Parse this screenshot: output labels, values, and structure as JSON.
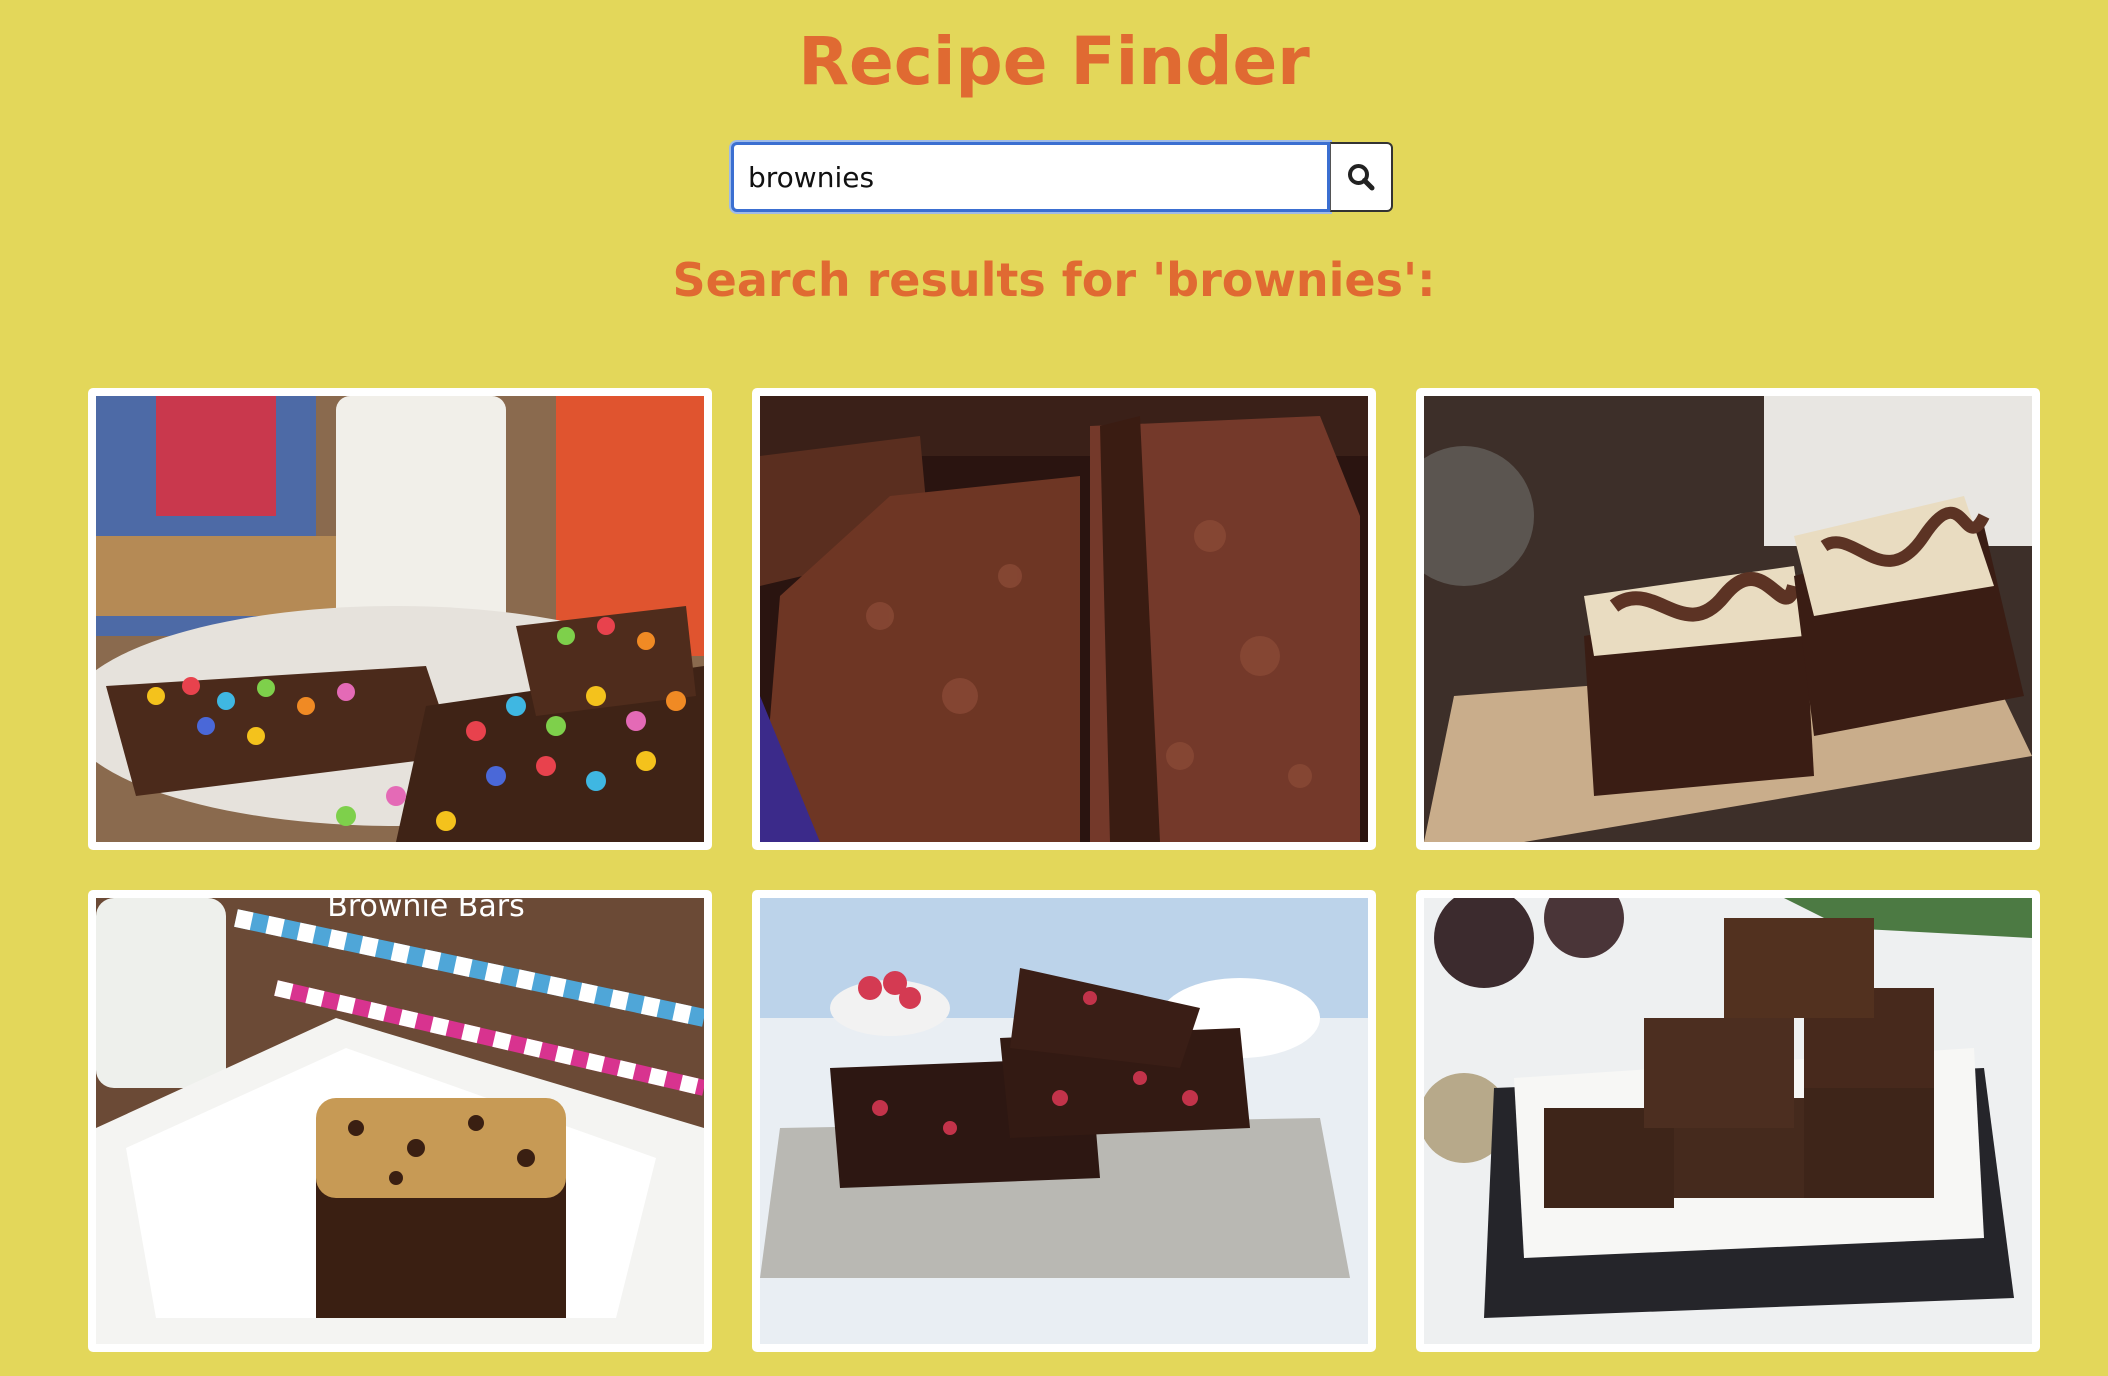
{
  "app": {
    "title": "Recipe Finder"
  },
  "search": {
    "value": "brownies",
    "button_icon": "search-icon"
  },
  "results": {
    "heading": "Search results for 'brownies':",
    "items": [
      {
        "image": "rainbow-chip-brownies-photo"
      },
      {
        "image": "fudgy-brownie-slices-photo"
      },
      {
        "image": "cheesecake-swirl-brownies-photo"
      },
      {
        "image": "cookie-dough-brownie-bar-photo",
        "overlay_text": "Brownie Bars"
      },
      {
        "image": "raspberry-brownies-photo"
      },
      {
        "image": "beetroot-brownies-in-tray-photo"
      }
    ]
  },
  "colors": {
    "background": "#e3d75a",
    "accent": "#e06a32",
    "focus_border": "#3b6fd1"
  }
}
